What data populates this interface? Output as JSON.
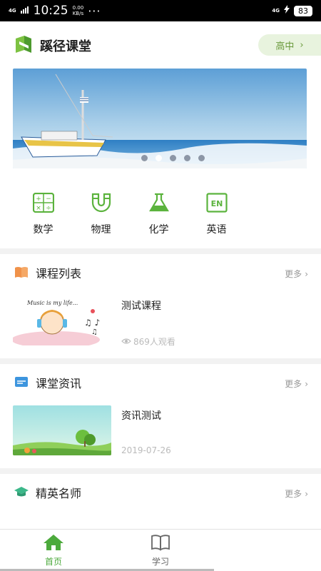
{
  "status_bar": {
    "network": "4G",
    "time": "10:25",
    "speed_value": "0.00",
    "speed_unit": "KB/s",
    "dots": "···",
    "network_right": "4G",
    "battery": "83"
  },
  "header": {
    "title": "蹊径课堂",
    "level_label": "高中",
    "level_chevron": "›"
  },
  "banner": {
    "slide_count": 5,
    "active_index": 1
  },
  "subjects": [
    {
      "label": "数学",
      "icon": "calculator-icon"
    },
    {
      "label": "物理",
      "icon": "magnet-icon"
    },
    {
      "label": "化学",
      "icon": "flask-icon"
    },
    {
      "label": "英语",
      "icon": "en-icon"
    }
  ],
  "course_section": {
    "title": "课程列表",
    "more_label": "更多",
    "item": {
      "title": "测试课程",
      "views": "869人观看",
      "thumb_text": "Music is my life..."
    }
  },
  "news_section": {
    "title": "课堂资讯",
    "more_label": "更多",
    "item": {
      "title": "资讯测试",
      "date": "2019-07-26"
    }
  },
  "teacher_section": {
    "title": "精英名师",
    "more_label": "更多"
  },
  "bottom_nav": [
    {
      "label": "首页",
      "icon": "home-icon",
      "active": true
    },
    {
      "label": "学习",
      "icon": "book-icon",
      "active": false
    }
  ],
  "colors": {
    "accent_green": "#4caa3c",
    "level_bg": "#e8f3de"
  }
}
